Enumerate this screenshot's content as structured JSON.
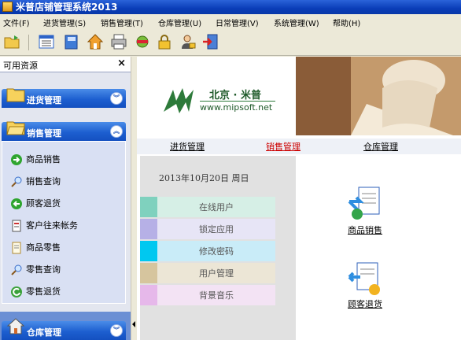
{
  "window": {
    "title": "米普店铺管理系统2013"
  },
  "menu": [
    "文件(F)",
    "进货管理(S)",
    "销售管理(T)",
    "仓库管理(U)",
    "日常管理(V)",
    "系统管理(W)",
    "帮助(H)"
  ],
  "toolbar": {
    "icons": [
      "open-folder-icon",
      "list-view-icon",
      "book-icon",
      "home-icon",
      "print-icon",
      "tools-icon",
      "lock-icon",
      "user-lock-icon",
      "exit-icon"
    ]
  },
  "panel": {
    "header": "可用资源",
    "close": "×",
    "groups": [
      {
        "label": "进货管理",
        "chevron": "︾"
      },
      {
        "label": "销售管理",
        "chevron": "︽"
      },
      {
        "label": "仓库管理",
        "chevron": "︾"
      }
    ],
    "items": [
      {
        "label": "商品销售"
      },
      {
        "label": "销售查询"
      },
      {
        "label": "顾客退货"
      },
      {
        "label": "客户往来帐务"
      },
      {
        "label": "商品零售"
      },
      {
        "label": "零售查询"
      },
      {
        "label": "零售退货"
      }
    ]
  },
  "banner": {
    "brand": "北京 · 米普",
    "url": "www.mipsoft.net"
  },
  "nav": [
    "进货管理",
    "销售管理",
    "仓库管理"
  ],
  "date": "2013年10月20日  周日",
  "quick_links": [
    {
      "label": "在线用户",
      "color": "#7fd1be",
      "bg": "#d6efe6"
    },
    {
      "label": "锁定应用",
      "color": "#b6b0e6",
      "bg": "#e7e5f6"
    },
    {
      "label": "修改密码",
      "color": "#00c8f0",
      "bg": "#c9ecf8"
    },
    {
      "label": "用户管理",
      "color": "#d6c59e",
      "bg": "#ece6d6"
    },
    {
      "label": "背景音乐",
      "color": "#e6b8ea",
      "bg": "#f3e3f4"
    }
  ],
  "shortcuts": [
    {
      "label": "商品销售"
    },
    {
      "label": "顾客退货"
    }
  ],
  "colors": {
    "titlebar": "#0a3db8",
    "group_header": "#1d5fd0",
    "active_nav": "#cc0000"
  }
}
